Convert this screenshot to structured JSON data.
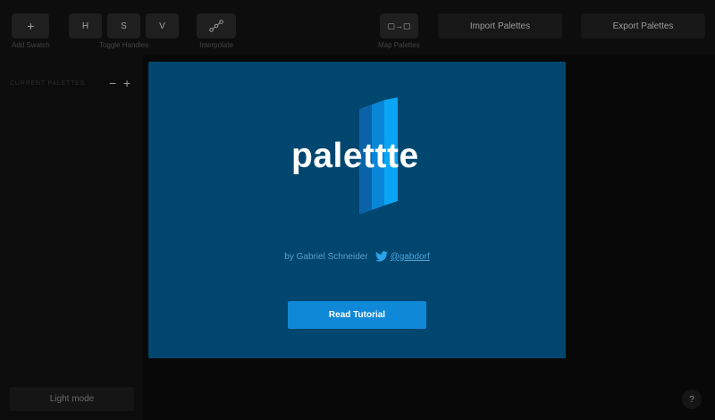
{
  "toolbar": {
    "add_swatch": {
      "icon": "+",
      "label": "Add Swatch"
    },
    "toggle_handles": {
      "buttons": [
        "H",
        "S",
        "V"
      ],
      "label": "Toggle Handles"
    },
    "interpolate": {
      "label": "Interpolate"
    },
    "map_palettes": {
      "icon": "▢→▢",
      "label": "Map Palettes"
    },
    "import_label": "Import Palettes",
    "export_label": "Export Palettes"
  },
  "sidebar": {
    "title": "Current Palettes",
    "minus": "−",
    "plus": "+",
    "light_mode": "Light mode"
  },
  "help": "?",
  "modal": {
    "logo_text": "palettte",
    "byline": "by Gabriel Schneider",
    "handle": "@gabdorf",
    "cta": "Read Tutorial"
  },
  "colors": {
    "modal_bg": "#00466e",
    "accent": "#1088d8",
    "logo_blue": "#0a9cf0"
  }
}
